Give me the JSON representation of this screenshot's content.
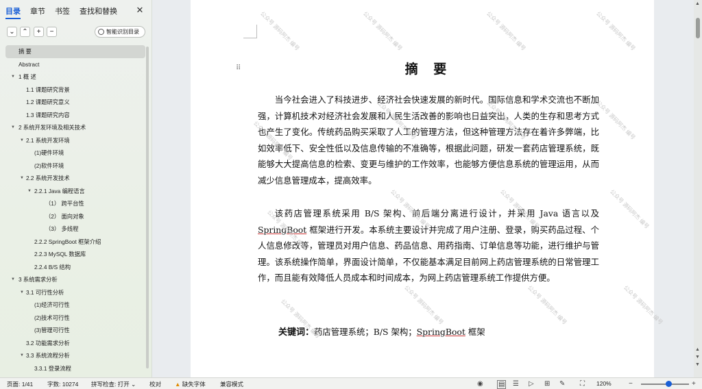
{
  "sidebar": {
    "tabs": [
      "目录",
      "章节",
      "书签",
      "查找和替换"
    ],
    "active_tab": "目录",
    "toolbar": {
      "collapse": "⌄",
      "expand": "⌃",
      "add": "+",
      "remove": "−"
    },
    "smart_toc_label": "智能识别目录",
    "toc": [
      {
        "label": "摘  要",
        "indent": 0,
        "arrow": "",
        "selected": true
      },
      {
        "label": "Abstract",
        "indent": 0,
        "arrow": ""
      },
      {
        "label": "1   概   述",
        "indent": 0,
        "arrow": "▼"
      },
      {
        "label": "1.1  课题研究背景",
        "indent": 1,
        "arrow": ""
      },
      {
        "label": "1.2  课题研究意义",
        "indent": 1,
        "arrow": ""
      },
      {
        "label": "1.3  课题研究内容",
        "indent": 1,
        "arrow": ""
      },
      {
        "label": "2   系统开发环境及相关技术",
        "indent": 0,
        "arrow": "▼"
      },
      {
        "label": "2.1  系统开发环境",
        "indent": 1,
        "arrow": "▼"
      },
      {
        "label": "(1)硬件环境",
        "indent": 2,
        "arrow": ""
      },
      {
        "label": "(2)软件环境",
        "indent": 2,
        "arrow": ""
      },
      {
        "label": "2.2  系统开发技术",
        "indent": 1,
        "arrow": "▼"
      },
      {
        "label": "2.2.1 Java 编程语言",
        "indent": 2,
        "arrow": "▼"
      },
      {
        "label": "（1） 跨平台性",
        "indent": 3,
        "arrow": ""
      },
      {
        "label": "（2） 面向对象",
        "indent": 3,
        "arrow": ""
      },
      {
        "label": "（3） 多线程",
        "indent": 3,
        "arrow": ""
      },
      {
        "label": "2.2.2   SpringBoot 框架介绍",
        "indent": 2,
        "arrow": ""
      },
      {
        "label": "2.2.3 MySQL 数据库",
        "indent": 2,
        "arrow": ""
      },
      {
        "label": "2.2.4 B/S 结构",
        "indent": 2,
        "arrow": ""
      },
      {
        "label": "3   系统需求分析",
        "indent": 0,
        "arrow": "▼"
      },
      {
        "label": "3.1  可行性分析",
        "indent": 1,
        "arrow": "▼"
      },
      {
        "label": "(1)经济可行性",
        "indent": 2,
        "arrow": ""
      },
      {
        "label": "(2)技术可行性",
        "indent": 2,
        "arrow": ""
      },
      {
        "label": "(3)管理可行性",
        "indent": 2,
        "arrow": ""
      },
      {
        "label": "3.2  功能需求分析",
        "indent": 1,
        "arrow": ""
      },
      {
        "label": "3.3  系统流程分析",
        "indent": 1,
        "arrow": "▼"
      },
      {
        "label": "3.3.1  登录流程",
        "indent": 2,
        "arrow": ""
      }
    ]
  },
  "document": {
    "title": "摘  要",
    "paragraph1": "当今社会进入了科技进步、经济社会快速发展的新时代。国际信息和学术交流也不断加强，计算机技术对经济社会发展和人民生活改善的影响也日益突出，人类的生存和思考方式也产生了变化。传统药品购买采取了人工的管理方法，但这种管理方法存在着许多弊端，比如效率低下、安全性低以及信息传输的不准确等，根据此问题，研发一套药店管理系统，既能够大大提高信息的检索、变更与维护的工作效率，也能够方便信息系统的管理运用，从而减少信息管理成本，提高效率。",
    "paragraph2_a": "该药店管理系统采用 B/S 架构、前后端分离进行设计，并采用 Java 语言以及 ",
    "paragraph2_sb": "SpringBoot",
    "paragraph2_b": " 框架进行开发。本系统主要设计并完成了用户注册、登录，购买药品过程、个人信息修改等，管理员对用户信息、药品信息、用药指南、订单信息等功能，进行维护与管理。该系统操作简单，界面设计简单，不仅能基本满足目前网上药店管理系统的日常管理工作，而且能有效降低人员成本和时间成本，为网上药店管理系统工作提供方便。",
    "keywords_label": "关键词：",
    "keywords_a": "药店管理系统；B/S  架构；",
    "keywords_sb": "SpringBoot",
    "keywords_b": " 框架",
    "watermark": "公众号 源码阿杰 编号"
  },
  "statusbar": {
    "page": "页面: 1/41",
    "words": "字数: 10274",
    "spellcheck": "拼写检查: 打开 ⌄",
    "proofread": "校对",
    "missing_font": "缺失字体",
    "compat": "兼容模式",
    "zoom": "120%",
    "zoom_minus": "−",
    "zoom_plus": "+"
  },
  "colors": {
    "accent": "#1a5fd6",
    "warning": "#e08a00"
  }
}
